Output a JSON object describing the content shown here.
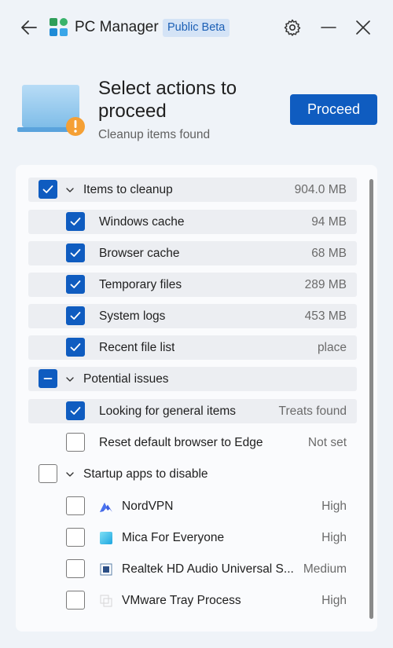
{
  "window": {
    "title": "PC Manager",
    "badge": "Public Beta"
  },
  "header": {
    "title": "Select actions to proceed",
    "subtitle": "Cleanup items found",
    "proceed_label": "Proceed"
  },
  "colors": {
    "accent": "#0f5cc0",
    "warning": "#f5a035"
  },
  "groups": [
    {
      "label": "Items to cleanup",
      "value": "904.0 MB",
      "state": "checked",
      "items": [
        {
          "label": "Windows cache",
          "value": "94 MB",
          "checked": true
        },
        {
          "label": "Browser cache",
          "value": "68 MB",
          "checked": true
        },
        {
          "label": "Temporary files",
          "value": "289 MB",
          "checked": true
        },
        {
          "label": "System logs",
          "value": "453 MB",
          "checked": true
        },
        {
          "label": "Recent file list",
          "value": "place",
          "checked": true
        }
      ]
    },
    {
      "label": "Potential issues",
      "value": "",
      "state": "partial",
      "items": [
        {
          "label": "Looking for general items",
          "value": "Treats found",
          "checked": true
        },
        {
          "label": "Reset default browser to Edge",
          "value": "Not set",
          "checked": false
        }
      ]
    },
    {
      "label": "Startup apps to disable",
      "value": "",
      "state": "unchecked",
      "items": [
        {
          "label": "NordVPN",
          "value": "High",
          "checked": false,
          "icon": "nordvpn-icon"
        },
        {
          "label": "Mica For Everyone",
          "value": "High",
          "checked": false,
          "icon": "mica-icon"
        },
        {
          "label": "Realtek HD Audio Universal S...",
          "value": "Medium",
          "checked": false,
          "icon": "realtek-icon"
        },
        {
          "label": "VMware Tray Process",
          "value": "High",
          "checked": false,
          "icon": "vmware-icon"
        }
      ]
    }
  ]
}
